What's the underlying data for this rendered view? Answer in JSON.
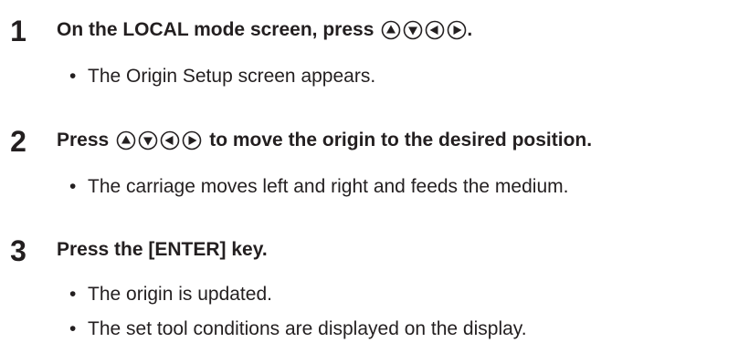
{
  "steps": [
    {
      "number": "1",
      "title_before": "On the LOCAL mode screen, press",
      "title_after": ".",
      "bullets": [
        "The Origin Setup screen appears."
      ]
    },
    {
      "number": "2",
      "title_before": "Press",
      "title_after": "to move the origin to the desired position.",
      "bullets": [
        "The carriage moves left and right and feeds the medium."
      ]
    },
    {
      "number": "3",
      "title_before": "Press the [ENTER] key.",
      "title_after": "",
      "bullets": [
        "The origin is updated.",
        "The set tool conditions are displayed on the display."
      ]
    }
  ],
  "bullet_glyph": "•",
  "icons": [
    "up-arrow-key-icon",
    "down-arrow-key-icon",
    "left-arrow-key-icon",
    "right-arrow-key-icon"
  ]
}
